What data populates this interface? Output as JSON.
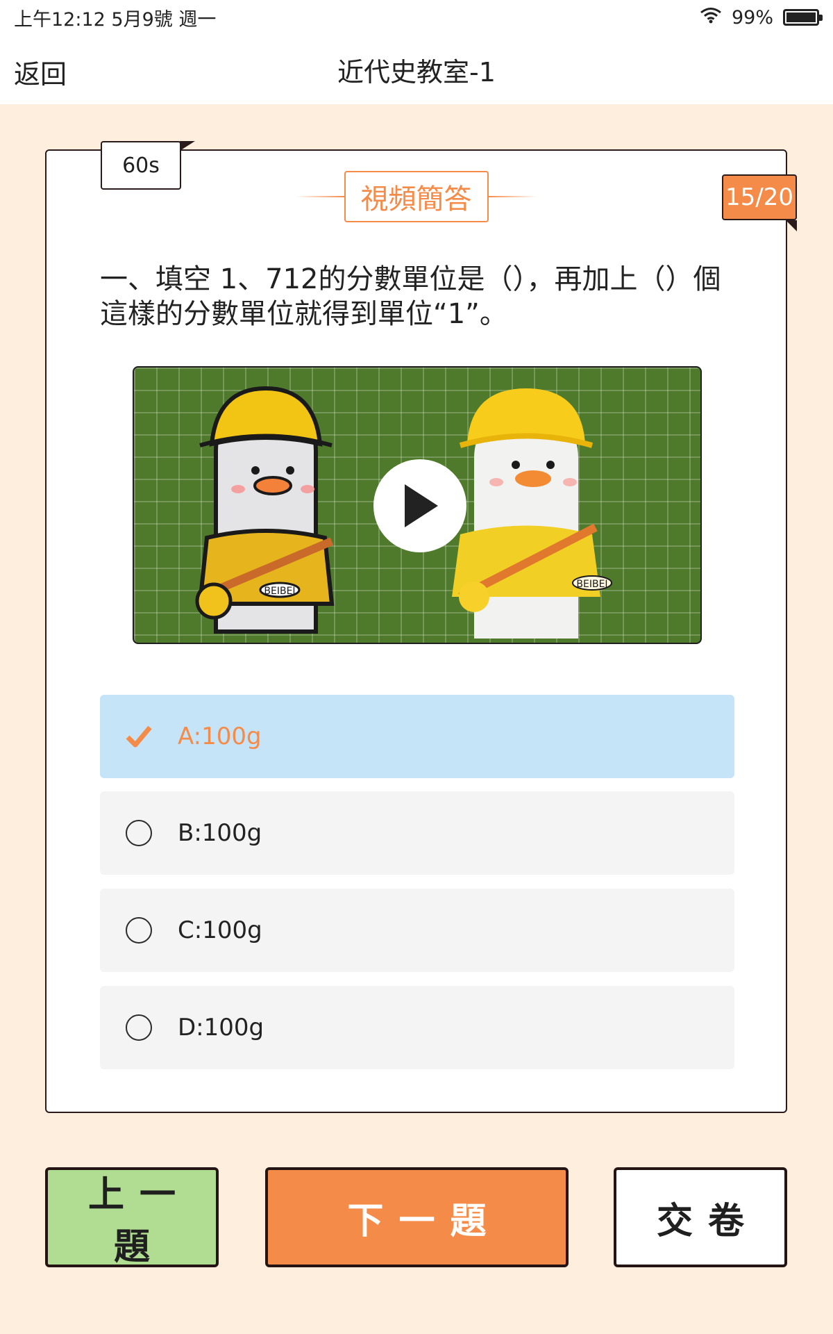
{
  "status_bar": {
    "time_date": "上午12:12  5月9號 週一",
    "battery_text": "99%",
    "battery_level": 0.99
  },
  "nav": {
    "back_label": "返回",
    "title": "近代史教室-1"
  },
  "quiz": {
    "timer": "60s",
    "type_label": "視頻簡答",
    "progress": "15/20",
    "question": "一、填空 1、712的分數單位是（），再加上（）個這樣的分數單位就得到單位“1”。",
    "options": [
      {
        "label": "A:100g",
        "selected": true
      },
      {
        "label": "B:100g",
        "selected": false
      },
      {
        "label": "C:100g",
        "selected": false
      },
      {
        "label": "D:100g",
        "selected": false
      }
    ],
    "mascot_text": "BEIBEI"
  },
  "buttons": {
    "prev": "上一題",
    "next": "下一題",
    "submit": "交卷"
  },
  "colors": {
    "accent": "#f58b48",
    "background": "#fdeedd",
    "selected_option": "#c6e4f8",
    "prev_button": "#b0dd91",
    "video_background": "#4f7a2c"
  }
}
